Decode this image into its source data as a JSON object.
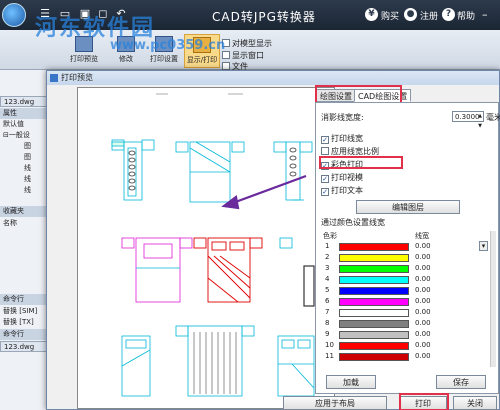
{
  "app": {
    "title": "CAD转JPG转换器",
    "buy_label": "购买",
    "register_label": "注册",
    "help_label": "帮助",
    "yen_icon": "¥",
    "user_icon": "●",
    "help_icon": "?"
  },
  "watermark": {
    "site_name": "河东软件园",
    "url": "www.pc0359.cn"
  },
  "ribbon": {
    "btn1": "打印预览",
    "btn2": "修改",
    "btn3": "打印设置",
    "btn4": "显示/打印",
    "opt1": "对模型显示",
    "opt2": "显示窗口",
    "opt3": "文件"
  },
  "left_panel": {
    "file_tab": "123.dwg",
    "props_hdr": "属性",
    "default_label": "默认值",
    "general_label": "一般设",
    "items": [
      "图",
      "图",
      "线",
      "线",
      "线"
    ],
    "favorites_hdr": "收藏夹",
    "name_label": "名称",
    "cmdline_hdr": "命令行",
    "cmd1": "替换 [SIM]",
    "cmd2": "替换 [TX]",
    "cmdline_hdr2": "命令行",
    "file_tab2": "123.dwg"
  },
  "dialog": {
    "title": "打印预览",
    "tabs": [
      "绘图设置",
      "CAD绘图设置"
    ],
    "linewidth_label": "消影线宽度:",
    "linewidth_value": "0.3000",
    "linewidth_unit": "毫米",
    "checkboxes": [
      {
        "label": "打印线宽",
        "checked": true
      },
      {
        "label": "应用线宽比例",
        "checked": false
      },
      {
        "label": "彩色打印",
        "checked": true
      },
      {
        "label": "打印视模",
        "checked": true
      },
      {
        "label": "打印文本",
        "checked": true
      }
    ],
    "edit_layer_btn": "编辑图层",
    "color_section_label": "通过颜色设置线宽",
    "col_color": "色彩",
    "col_width": "线宽",
    "color_rows": [
      {
        "n": "1",
        "color": "#ff0000",
        "w": "0.00"
      },
      {
        "n": "2",
        "color": "#ffff00",
        "w": "0.00"
      },
      {
        "n": "3",
        "color": "#00ff00",
        "w": "0.00"
      },
      {
        "n": "4",
        "color": "#00ffff",
        "w": "0.00"
      },
      {
        "n": "5",
        "color": "#0000ff",
        "w": "0.00"
      },
      {
        "n": "6",
        "color": "#ff00ff",
        "w": "0.00"
      },
      {
        "n": "7",
        "color": "#ffffff",
        "w": "0.00"
      },
      {
        "n": "8",
        "color": "#808080",
        "w": "0.00"
      },
      {
        "n": "9",
        "color": "#c0c0c0",
        "w": "0.00"
      },
      {
        "n": "10",
        "color": "#ff0000",
        "w": "0.00"
      },
      {
        "n": "11",
        "color": "#cc0000",
        "w": "0.00"
      }
    ],
    "load_btn": "加载",
    "save_btn": "保存",
    "apply_layout_btn": "应用于布局",
    "print_btn": "打印",
    "close_btn": "关闭"
  },
  "colors": {
    "highlight": "#e0304a",
    "arrow": "#6a2a9c"
  }
}
